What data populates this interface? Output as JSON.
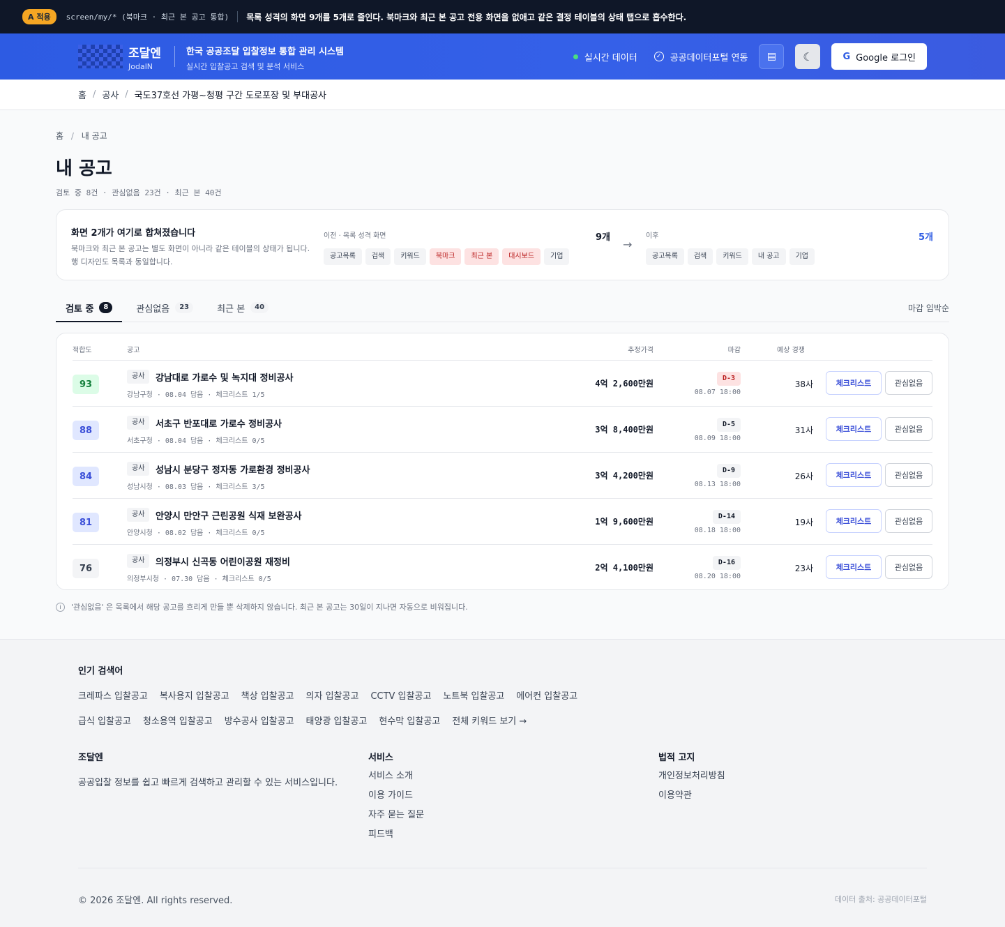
{
  "banner": {
    "badge": "A 적용",
    "path": "screen/my/* (북마크 · 최근 본 공고 통합)",
    "message": "목록 성격의 화면 9개를 5개로 줄인다. 북마크와 최근 본 공고 전용 화면을 없애고 같은 결정 테이블의 상태 탭으로 흡수한다."
  },
  "header": {
    "brand_name": "조달엔",
    "brand_sub": "JodalN",
    "system_title": "한국 공공조달 입찰정보 통합 관리 시스템",
    "system_sub": "실시간 입찰공고 검색 및 분석 서비스",
    "live_label": "실시간 데이터",
    "portal_label": "공공데이터포털 연동",
    "login_label": "Google 로그인",
    "colors": {
      "primary": "#2d5be3",
      "live_dot": "#4ade80"
    }
  },
  "breadcrumb_top": {
    "home": "홈",
    "category": "공사",
    "current": "국도37호선 가평~청평 구간 도로포장 및 부대공사"
  },
  "page": {
    "crumb_home": "홈",
    "crumb_current": "내 공고",
    "title": "내 공고",
    "summary": "검토 중 8건 · 관심없음 23건 · 최근 본 40건"
  },
  "merge_card": {
    "heading": "화면 2개가 여기로 합쳐졌습니다",
    "description": "북마크와 최근 본 공고는 별도 화면이 아니라 같은 테이블의 상태가 됩니다. 행 디자인도 목록과 동일합니다.",
    "before_label": "이전 · 목록 성격 화면",
    "before_count": "9개",
    "before_chips": [
      {
        "label": "공고목록",
        "removed": false
      },
      {
        "label": "검색",
        "removed": false
      },
      {
        "label": "키워드",
        "removed": false
      },
      {
        "label": "북마크",
        "removed": true
      },
      {
        "label": "최근 본",
        "removed": true
      },
      {
        "label": "대시보드",
        "removed": true
      },
      {
        "label": "기업",
        "removed": false
      }
    ],
    "after_label": "이후",
    "after_count": "5개",
    "after_chips": [
      "공고목록",
      "검색",
      "키워드",
      "내 공고",
      "기업"
    ]
  },
  "tabs": [
    {
      "label": "검토 중",
      "count": "8",
      "active": true
    },
    {
      "label": "관심없음",
      "count": "23",
      "active": false
    },
    {
      "label": "최근 본",
      "count": "40",
      "active": false
    }
  ],
  "sort_label": "마감 임박순",
  "table": {
    "headers": {
      "fit": "적합도",
      "notice": "공고",
      "price": "추정가격",
      "deadline": "마감",
      "competition": "예상 경쟁"
    },
    "rows": [
      {
        "score": "93",
        "score_tone": "green",
        "category": "공사",
        "title": "강남대로 가로수 및 녹지대 정비공사",
        "meta": "강남구청 · 08.04 담음 · 체크리스트 1/5",
        "price": "4억 2,600만원",
        "dday": "D-3",
        "urgent": true,
        "deadline": "08.07 18:00",
        "competition": "38사",
        "checklist_label": "체크리스트",
        "dismiss_label": "관심없음"
      },
      {
        "score": "88",
        "score_tone": "blue",
        "category": "공사",
        "title": "서초구 반포대로 가로수 정비공사",
        "meta": "서초구청 · 08.04 담음 · 체크리스트 0/5",
        "price": "3억 8,400만원",
        "dday": "D-5",
        "urgent": false,
        "deadline": "08.09 18:00",
        "competition": "31사",
        "checklist_label": "체크리스트",
        "dismiss_label": "관심없음"
      },
      {
        "score": "84",
        "score_tone": "blue",
        "category": "공사",
        "title": "성남시 분당구 정자동 가로환경 정비공사",
        "meta": "성남시청 · 08.03 담음 · 체크리스트 3/5",
        "price": "3억 4,200만원",
        "dday": "D-9",
        "urgent": false,
        "deadline": "08.13 18:00",
        "competition": "26사",
        "checklist_label": "체크리스트",
        "dismiss_label": "관심없음"
      },
      {
        "score": "81",
        "score_tone": "blue",
        "category": "공사",
        "title": "안양시 만안구 근린공원 식재 보완공사",
        "meta": "안양시청 · 08.02 담음 · 체크리스트 0/5",
        "price": "1억 9,600만원",
        "dday": "D-14",
        "urgent": false,
        "deadline": "08.18 18:00",
        "competition": "19사",
        "checklist_label": "체크리스트",
        "dismiss_label": "관심없음"
      },
      {
        "score": "76",
        "score_tone": "gray",
        "category": "공사",
        "title": "의정부시 신곡동 어린이공원 재정비",
        "meta": "의정부시청 · 07.30 담음 · 체크리스트 0/5",
        "price": "2억 4,100만원",
        "dday": "D-16",
        "urgent": false,
        "deadline": "08.20 18:00",
        "competition": "23사",
        "checklist_label": "체크리스트",
        "dismiss_label": "관심없음"
      }
    ]
  },
  "note": "'관심없음' 은 목록에서 해당 공고를 흐리게 만들 뿐 삭제하지 않습니다. 최근 본 공고는 30일이 지나면 자동으로 비워집니다.",
  "footer": {
    "popular_heading": "인기 검색어",
    "keywords_row1": [
      "크레파스 입찰공고",
      "복사용지 입찰공고",
      "책상 입찰공고",
      "의자 입찰공고",
      "CCTV 입찰공고",
      "노트북 입찰공고",
      "에어컨 입찰공고"
    ],
    "keywords_row2": [
      "급식 입찰공고",
      "청소용역 입찰공고",
      "방수공사 입찰공고",
      "태양광 입찰공고",
      "현수막 입찰공고",
      "전체 키워드 보기 →"
    ],
    "about_heading": "조달엔",
    "about_text": "공공입찰 정보를 쉽고 빠르게 검색하고 관리할 수 있는 서비스입니다.",
    "service_heading": "서비스",
    "service_links": [
      "서비스 소개",
      "이용 가이드",
      "자주 묻는 질문",
      "피드백"
    ],
    "legal_heading": "법적 고지",
    "legal_links": [
      "개인정보처리방침",
      "이용약관"
    ],
    "copyright": "© 2026 조달엔. All rights reserved.",
    "source": "데이터 출처: 공공데이터포털"
  }
}
